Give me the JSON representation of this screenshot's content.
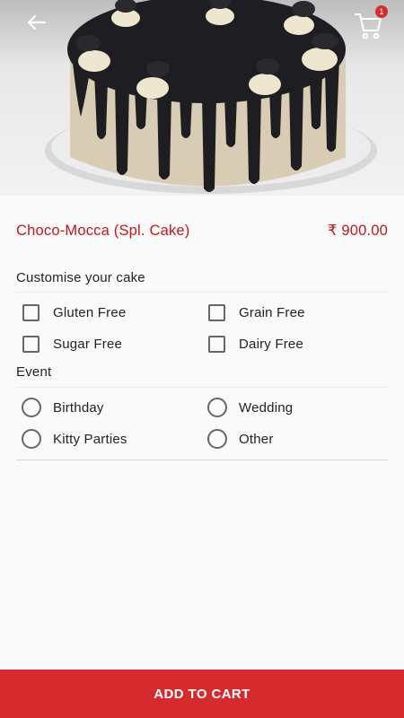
{
  "product": {
    "name": "Choco-Mocca (Spl. Cake)",
    "price": "₹ 900.00"
  },
  "cart": {
    "count": "1"
  },
  "customise": {
    "label": "Customise your cake",
    "options": [
      {
        "label": "Gluten Free",
        "checked": false
      },
      {
        "label": "Grain Free",
        "checked": false
      },
      {
        "label": "Sugar Free",
        "checked": false
      },
      {
        "label": "Dairy Free",
        "checked": false
      }
    ]
  },
  "event": {
    "label": "Event",
    "options": [
      {
        "label": "Birthday",
        "selected": false
      },
      {
        "label": "Wedding",
        "selected": false
      },
      {
        "label": "Kitty Parties",
        "selected": false
      },
      {
        "label": "Other",
        "selected": false
      }
    ]
  },
  "actions": {
    "add_to_cart": "ADD TO CART"
  },
  "icons": {
    "back": "arrow-left-icon",
    "cart": "shopping-cart-icon"
  },
  "colors": {
    "accent": "#c4161c",
    "button": "#d52b2e"
  }
}
